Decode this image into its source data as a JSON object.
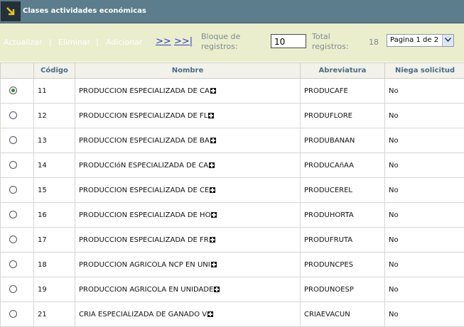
{
  "window": {
    "title": "Clases actividades económicas"
  },
  "toolbar": {
    "actualizar": "Actualizar",
    "eliminar": "Eliminar",
    "adicionar": "Adicionar",
    "separator": "|",
    "next": ">>",
    "last": ">>|",
    "bloque_label_1": "Bloque de",
    "bloque_label_2": "registros:",
    "bloque_value": "10",
    "total_label_1": "Total",
    "total_label_2": "registros:",
    "total_value": "18",
    "pager_value": "Pagina 1 de 2"
  },
  "table": {
    "columns": [
      "Código",
      "Nombre",
      "Abreviatura",
      "Niega solicitud"
    ],
    "rows": [
      {
        "selected": true,
        "codigo": "11",
        "nombre": "PRODUCCION ESPECIALIZADA DE CA",
        "abreviatura": "PRODUCAFE",
        "niega": "No"
      },
      {
        "selected": false,
        "codigo": "12",
        "nombre": "PRODUCCION ESPECIALIZADA DE FL",
        "abreviatura": "PRODUFLORE",
        "niega": "No"
      },
      {
        "selected": false,
        "codigo": "13",
        "nombre": "PRODUCCION ESPECIALIZADA DE BA",
        "abreviatura": "PRODUBANAN",
        "niega": "No"
      },
      {
        "selected": false,
        "codigo": "14",
        "nombre": "PRODUCCIóN ESPECIALIZADA DE CA",
        "abreviatura": "PRODUCAñAA",
        "niega": "No"
      },
      {
        "selected": false,
        "codigo": "15",
        "nombre": "PRODUCCION ESPECIALIZADA DE CE",
        "abreviatura": "PRODUCEREL",
        "niega": "No"
      },
      {
        "selected": false,
        "codigo": "16",
        "nombre": "PRODUCCION ESPECIALIZADA DE HO",
        "abreviatura": "PRODUHORTA",
        "niega": "No"
      },
      {
        "selected": false,
        "codigo": "17",
        "nombre": "PRODUCCION ESPECIALIZADA DE FR",
        "abreviatura": "PRODUFRUTA",
        "niega": "No"
      },
      {
        "selected": false,
        "codigo": "18",
        "nombre": "PRODUCCION AGRICOLA NCP EN UNI",
        "abreviatura": "PRODUNCPES",
        "niega": "No"
      },
      {
        "selected": false,
        "codigo": "19",
        "nombre": "PRODUCCION AGRICOLA EN UNIDADE",
        "abreviatura": "PRODUNOESP",
        "niega": "No"
      },
      {
        "selected": false,
        "codigo": "21",
        "nombre": "CRIA ESPECIALIZADA DE GANADO V",
        "abreviatura": "CRIAEVACUN",
        "niega": "No"
      }
    ]
  },
  "icons": {
    "title_icon": "collapse-arrow-icon",
    "expand_icon": "plus-box-icon",
    "dropdown_icon": "chevron-down-icon"
  },
  "colors": {
    "titlebar": "#5b7d8c",
    "toolbar": "#eaeecc",
    "header_text": "#4a6a86",
    "nav_link": "#2a3bd8",
    "radio_selected": "#2f8a2f"
  }
}
